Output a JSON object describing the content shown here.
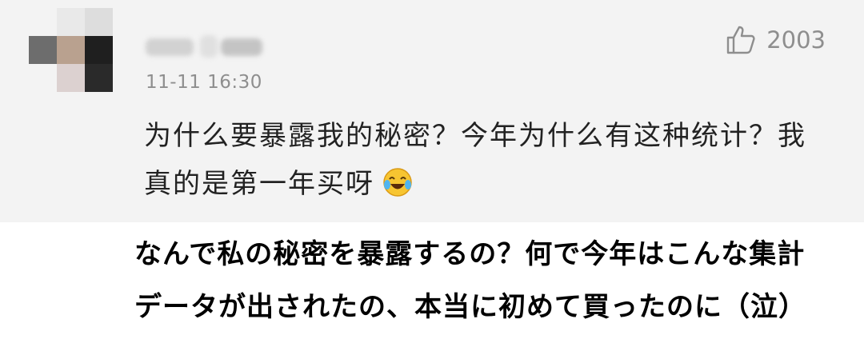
{
  "comment": {
    "timestamp": "11-11 16:30",
    "like_count": "2003",
    "like_icon": "thumbs-up-icon",
    "text": "为什么要暴露我的秘密？今年为什么有这种统计？我真的是第一年买呀",
    "emoji": "laughing-crying-emoji"
  },
  "subtitle": {
    "line1": "なんで私の秘密を暴露するの？何で今年はこんな集計",
    "line2": "データが出されたの、本当に初めて買ったのに（泣）"
  },
  "colors": {
    "background": "#f3f3f3",
    "meta_text": "#8e8e8e",
    "comment_text": "#222222",
    "subtitle_text": "#000000"
  }
}
